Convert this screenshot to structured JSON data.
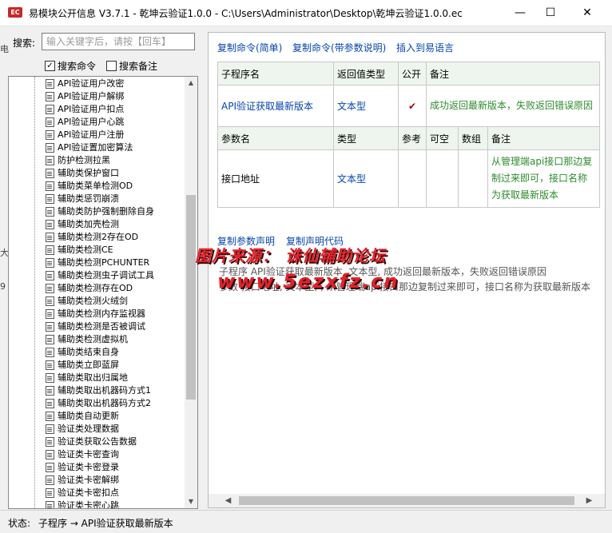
{
  "window": {
    "app_icon_text": "EC",
    "title": "易模块公开信息 V3.7.1 - 乾坤云验证1.0.0 - C:\\Users\\Administrator\\Desktop\\乾坤云验证1.0.0.ec",
    "min_glyph": "—",
    "max_glyph": "☐",
    "close_glyph": "✕"
  },
  "search": {
    "label": "搜索:",
    "placeholder": "输入关键字后，请按【回车】",
    "value": "",
    "search_commands_label": "搜索命令",
    "search_commands_checked": "✓",
    "search_notes_label": "搜索备注",
    "search_notes_checked": ""
  },
  "tree": {
    "items": [
      "API验证用户改密",
      "API验证用户解绑",
      "API验证用户扣点",
      "API验证用户心跳",
      "API验证用户注册",
      "API验证置加密算法",
      "防护检测拉黑",
      "辅助类保护窗口",
      "辅助类菜单检测OD",
      "辅助类惩罚崩溃",
      "辅助类防护强制删除自身",
      "辅助类加壳检测",
      "辅助类检测2存在OD",
      "辅助类检测CE",
      "辅助类检测PCHUNTER",
      "辅助类检测虫子调试工具",
      "辅助类检测存在OD",
      "辅助类检测火绒剑",
      "辅助类检测内存监视器",
      "辅助类检测是否被调试",
      "辅助类检测虚拟机",
      "辅助类结束自身",
      "辅助类立即蓝屏",
      "辅助类取出归属地",
      "辅助类取出机器码方式1",
      "辅助类取出机器码方式2",
      "辅助类自动更新",
      "验证类处理数据",
      "验证类获取公告数据",
      "验证类卡密查询",
      "验证类卡密登录",
      "验证类卡密解绑",
      "验证类卡密扣点",
      "验证类卡密心跳"
    ]
  },
  "actions": {
    "copy_simple": "复制命令(简单)",
    "copy_with_params": "复制命令(带参数说明)",
    "insert_to_e": "插入到易语言"
  },
  "sub": {
    "headers": [
      "子程序名",
      "返回值类型",
      "公开",
      "备注"
    ],
    "name": "API验证获取最新版本",
    "return_type": "文本型",
    "public_mark": "✔",
    "note": "成功返回最新版本，失败返回错误原因"
  },
  "params": {
    "headers": [
      "参数名",
      "类型",
      "参考",
      "可空",
      "数组",
      "备注"
    ],
    "rows": [
      {
        "name": "接口地址",
        "type": "文本型",
        "ref": "",
        "nullable": "",
        "array": "",
        "note": "从管理端api接口那边复制过来即可，接口名称为获取最新版本"
      }
    ]
  },
  "declaration": {
    "copy_param_decl": "复制参数声明",
    "copy_decl_code": "复制声明代码",
    "line1": "子程序 API验证获取最新版本, 文本型, 成功返回最新版本，失败返回错误原因",
    "line2": "参数 接口地址, 文本型, , 从管理端api接口那边复制过来即可，接口名称为获取最新版本"
  },
  "watermark": {
    "line1": "图片来源： 诛仙辅助论坛",
    "line2": "www.5ezxfz.cn"
  },
  "status": {
    "label": "状态:",
    "value": "子程序 → API验证获取最新版本"
  },
  "edge_fragments": [
    "电",
    "大",
    "9"
  ],
  "colors": {
    "link": "#0645ad",
    "note_green": "#2e8b2e",
    "watermark_red": "#e0222a",
    "header_bg": "#eef5ee"
  }
}
